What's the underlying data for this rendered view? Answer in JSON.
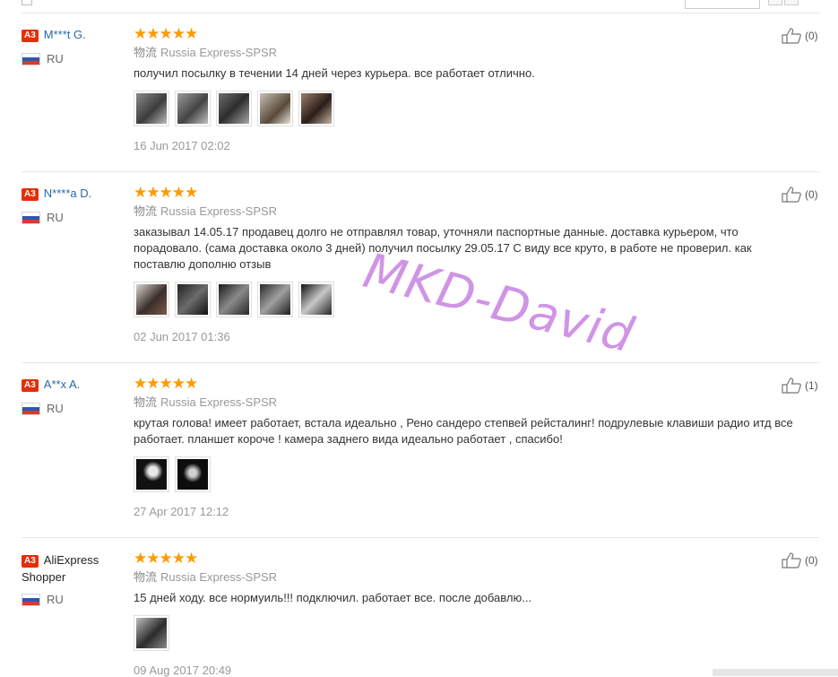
{
  "reviews": [
    {
      "badge": "A3",
      "name": "M***t G.",
      "country": "RU",
      "stars": "★★★★★",
      "logistics_cn": "物流",
      "logistics": "Russia Express-SPSR",
      "text": "получил посылку в течении 14 дней через курьера. все работает отлично.",
      "date": "16 Jun 2017 02:02",
      "useful": "(0)",
      "thumbs": 5
    },
    {
      "badge": "A3",
      "name": "N****a D.",
      "country": "RU",
      "stars": "★★★★★",
      "logistics_cn": "物流",
      "logistics": "Russia Express-SPSR",
      "text": "заказывал 14.05.17 продавец долго не отправлял товар, уточняли паспортные данные. доставка курьером, что порадовало. (сама доставка около 3 дней) получил посылку 29.05.17 С виду все круто, в работе не проверил. как поставлю дополню отзыв",
      "date": "02 Jun 2017 01:36",
      "useful": "(0)",
      "thumbs": 5
    },
    {
      "badge": "A3",
      "name": "A**x A.",
      "country": "RU",
      "stars": "★★★★★",
      "logistics_cn": "物流",
      "logistics": "Russia Express-SPSR",
      "text": "крутая голова! имеет работает, встала идеально , Рено сандеро степвей рейсталинг! подрулевые клавиши радио итд все работает. планшет короче ! камера заднего вида идеально работает , спасибо!",
      "date": "27 Apr 2017 12:12",
      "useful": "(1)",
      "thumbs": 2
    },
    {
      "badge": "A3",
      "name": "AliExpress Shopper",
      "country": "RU",
      "stars": "★★★★★",
      "logistics_cn": "物流",
      "logistics": "Russia Express-SPSR",
      "text": "15 дней ходу. все нормуиль!!! подключил. работает все. после добавлю...",
      "date": "09 Aug 2017 20:49",
      "useful": "(0)",
      "thumbs": 1
    }
  ],
  "watermark": "MKD-David",
  "colors": {
    "star": "#ff9a00",
    "badge": "#e62e04",
    "name_link": "#2a6aa8"
  },
  "icons": {
    "thumbs_up": "thumbs-up-icon",
    "flag": "russia-flag-icon"
  }
}
